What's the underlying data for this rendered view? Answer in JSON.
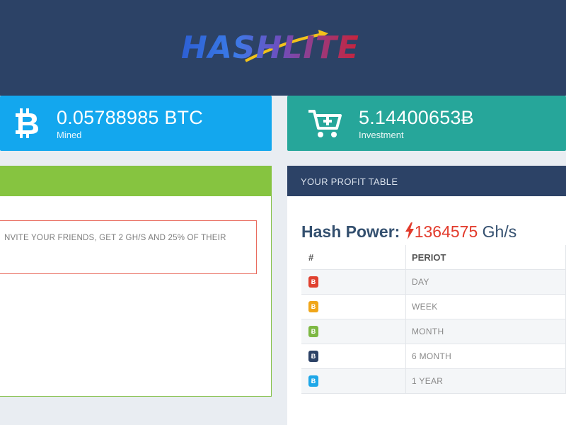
{
  "header": {
    "logo_text": "HASHLITE",
    "colors": {
      "background": "#2c4266"
    }
  },
  "stats": {
    "mined": {
      "value": "0.05788985 BTC",
      "label": "Mined",
      "icon": "bitcoin-icon",
      "color": "#13a7ee"
    },
    "investment": {
      "value": "5.14400653Ƀ",
      "label": "Investment",
      "icon": "cart-plus-icon",
      "color": "#26a69a"
    }
  },
  "referral": {
    "text": "NVITE YOUR FRIENDS, GET 2 GH/S AND 25% OF THEIR",
    "colors": {
      "bar": "#86c440",
      "border": "#e96b5e"
    }
  },
  "profit_table": {
    "title": "YOUR PROFIT TABLE",
    "hash_power_label": "Hash Power:",
    "hash_power_value": "1364575",
    "hash_power_unit": "Gh/s",
    "columns": [
      "#",
      "PERIOT"
    ],
    "rows": [
      {
        "badge": "Ƀ",
        "badge_color": "#e0412f",
        "period": "DAY"
      },
      {
        "badge": "Ƀ",
        "badge_color": "#f0a61a",
        "period": "WEEK"
      },
      {
        "badge": "Ƀ",
        "badge_color": "#7db843",
        "period": "MONTH"
      },
      {
        "badge": "Ƀ",
        "badge_color": "#2c4266",
        "period": "6 MONTH"
      },
      {
        "badge": "Ƀ",
        "badge_color": "#1ea7e8",
        "period": "1 YEAR"
      }
    ]
  }
}
